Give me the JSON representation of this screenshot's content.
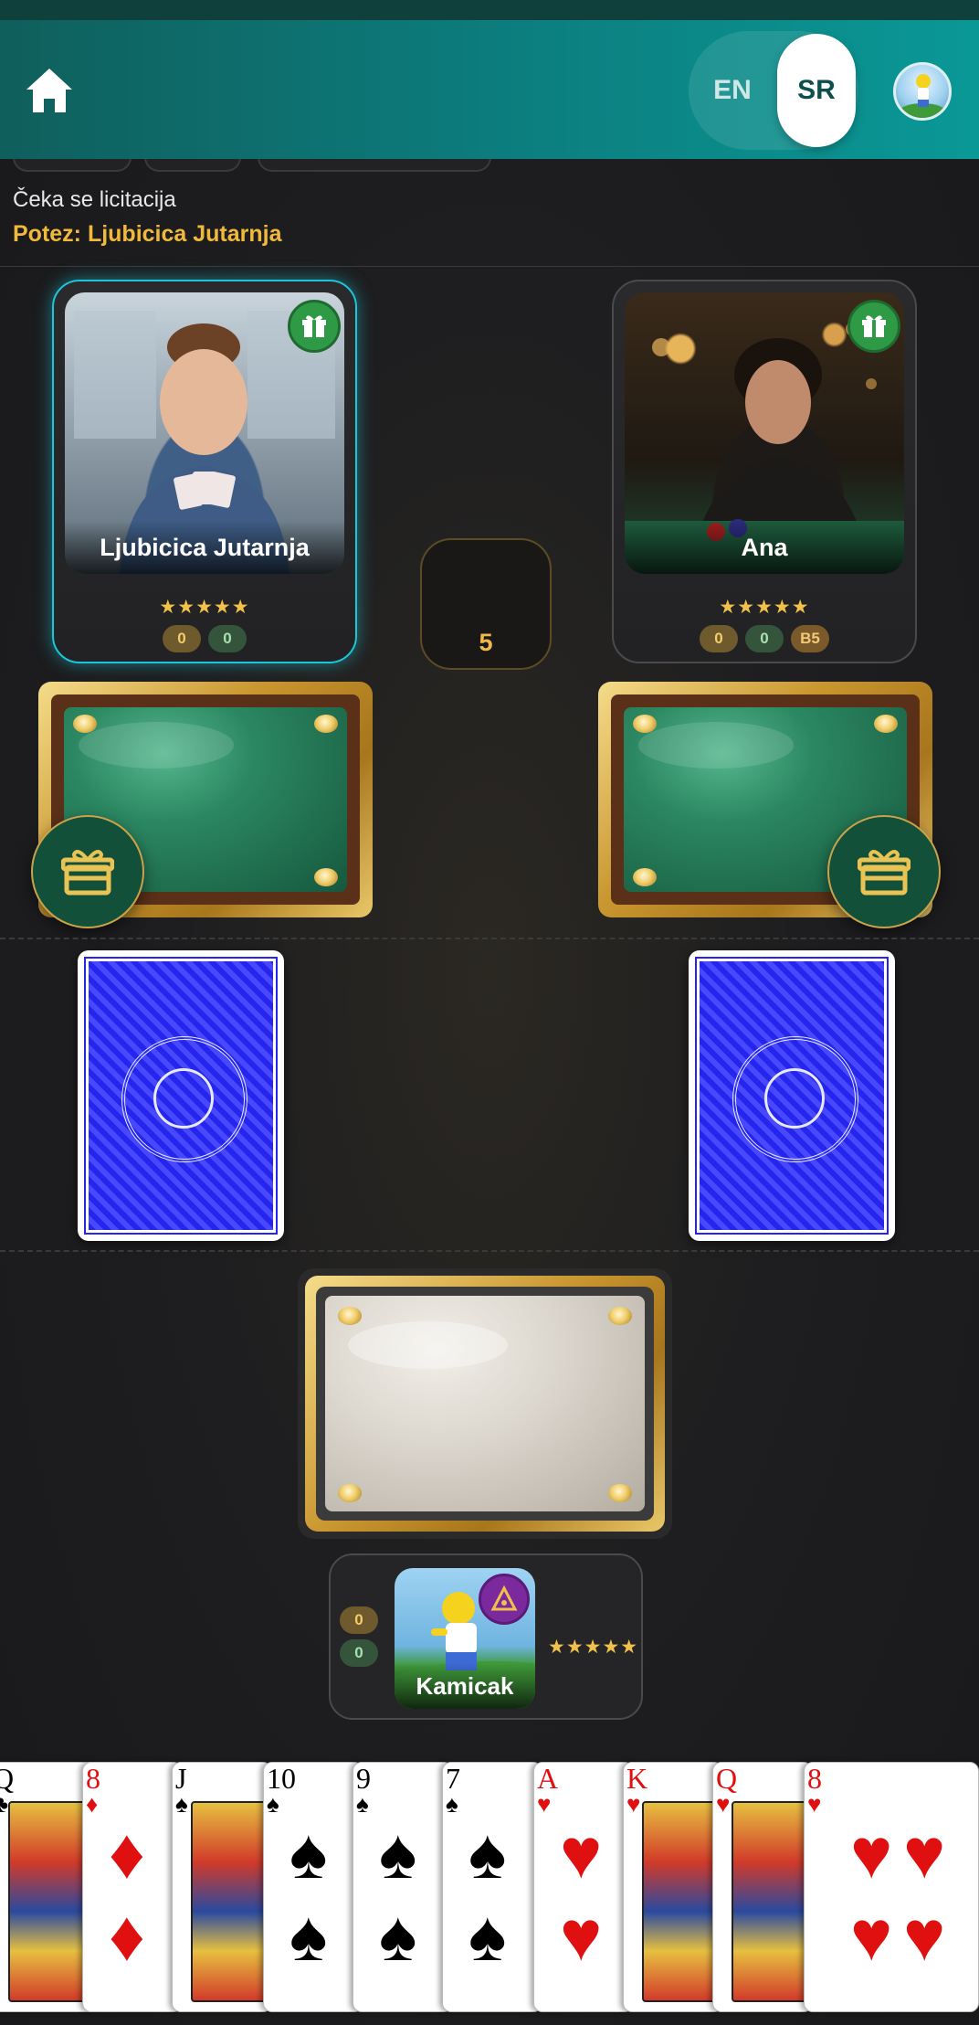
{
  "header": {
    "lang_en": "EN",
    "lang_sr": "SR",
    "home_icon": "home-icon",
    "active_lang": "SR"
  },
  "game": {
    "status": "Čeka se licitacija",
    "turn": "Potez: Ljubicica Jutarnja",
    "center_counter": "5"
  },
  "players": {
    "left": {
      "name": "Ljubicica Jutarnja",
      "stars": "★★★★★",
      "score_a": "0",
      "score_b": "0",
      "active": true
    },
    "right": {
      "name": "Ana",
      "stars": "★★★★★",
      "score_a": "0",
      "score_b": "0",
      "badge": "B5",
      "active": false
    },
    "me": {
      "name": "Kamicak",
      "stars": "★★★★★",
      "score_a": "0",
      "score_b": "0"
    }
  },
  "hand": [
    {
      "rank": "Q",
      "suit": "♣",
      "color": "black"
    },
    {
      "rank": "8",
      "suit": "♦",
      "color": "red"
    },
    {
      "rank": "J",
      "suit": "♠",
      "color": "black"
    },
    {
      "rank": "10",
      "suit": "♠",
      "color": "black"
    },
    {
      "rank": "9",
      "suit": "♠",
      "color": "black"
    },
    {
      "rank": "7",
      "suit": "♠",
      "color": "black"
    },
    {
      "rank": "A",
      "suit": "♥",
      "color": "red"
    },
    {
      "rank": "K",
      "suit": "♥",
      "color": "red"
    },
    {
      "rank": "Q",
      "suit": "♥",
      "color": "red"
    },
    {
      "rank": "8",
      "suit": "♥",
      "color": "red"
    }
  ],
  "colors": {
    "header_start": "#0f5f5c",
    "header_end": "#0a9896",
    "accent_gold": "#f1b93c",
    "active_glow": "#1cc6d8"
  }
}
